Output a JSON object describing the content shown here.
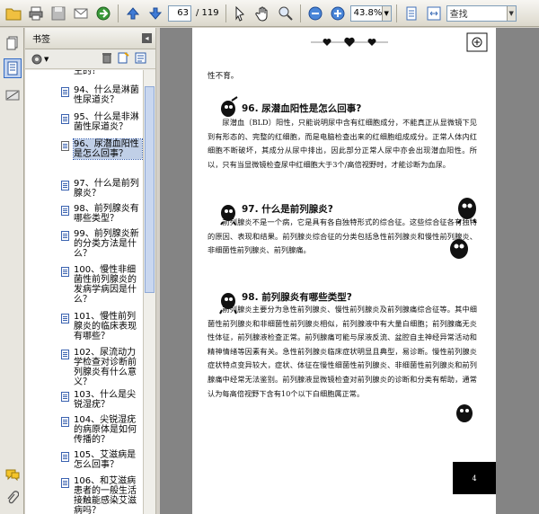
{
  "toolbar": {
    "page_current": "63",
    "page_total": "/ 119",
    "zoom": "43.8%",
    "search_placeholder": "查找"
  },
  "bookmarks": {
    "title": "书签",
    "items": [
      {
        "text": "生的？",
        "selected": false
      },
      {
        "text": "94、什么是淋菌性尿道炎？",
        "selected": false
      },
      {
        "text": "95、什么是非淋菌性尿道炎？",
        "selected": false
      },
      {
        "text": "96、尿潜血阳性是怎么回事？",
        "selected": true
      },
      {
        "text": "97、什么是前列腺炎？",
        "selected": false
      },
      {
        "text": "98、前列腺炎有哪些类型？",
        "selected": false
      },
      {
        "text": "99、前列腺炎新的分类方法是什么？",
        "selected": false
      },
      {
        "text": "100、慢性非细菌性前列腺炎的发病学病因是什么？",
        "selected": false
      },
      {
        "text": "101、慢性前列腺炎的临床表现有哪些？",
        "selected": false
      },
      {
        "text": "102、尿流动力学检查对诊断前列腺炎有什么意义？",
        "selected": false
      },
      {
        "text": "103、什么是尖锐湿疣？",
        "selected": false
      },
      {
        "text": "104、尖锐湿疣的病原体是如何传播的？",
        "selected": false
      },
      {
        "text": "105、艾滋病是怎么回事？",
        "selected": false
      },
      {
        "text": "106、和艾滋病患者的一般生活接触能感染艾滋病吗？",
        "selected": false
      }
    ]
  },
  "page": {
    "prev_tail": "性不育。",
    "sections": [
      {
        "heading": "96. 尿潜血阳性是怎么回事?",
        "paragraphs": [
          "尿潜血（BLD）阳性，只能说明尿中含有红细胞成分，不能真正从显微镜下见到有形态的、完整的红细胞，而是电脑检查出来的红细胞组成成分。正常人体内红细胞不断破坏，其成分从尿中排出，因此部分正常人尿中亦会出现潜血阳性。所以，只有当显微镜检查尿中红细胞大于3个/高倍视野时，才能诊断为血尿。"
        ]
      },
      {
        "heading": "97. 什么是前列腺炎?",
        "paragraphs": [
          "前列腺炎不是一个病，它是具有各自独特形式的综合征。这些综合征各有独特的原因、表现和结果。前列腺炎综合征的分类包括急性前列腺炎和慢性前列腺炎、非细菌性前列腺炎、前列腺痛。"
        ]
      },
      {
        "heading": "98. 前列腺炎有哪些类型?",
        "paragraphs": [
          "前列腺炎主要分为急性前列腺炎、慢性前列腺炎及前列腺痛综合征等。其中细菌性前列腺炎和非细菌性前列腺炎相似，前列腺液中有大量白细胞；前列腺痛无炎性体征，前列腺液检查正常。前列腺痛可能与尿液反流、盆腔自主神经异常活动和精神情绪等因素有关。急性前列腺炎临床症状明显且典型，易诊断。慢性前列腺炎症状特点变异较大，症状、体征在慢性细菌性前列腺炎、非细菌性前列腺炎和前列腺痛中经常无法鉴别。前列腺液显微镜检查对前列腺炎的诊断和分类有帮助，通常认为每高倍视野下含有10个以下白细胞属正常。"
        ]
      }
    ],
    "page_number": "4"
  }
}
